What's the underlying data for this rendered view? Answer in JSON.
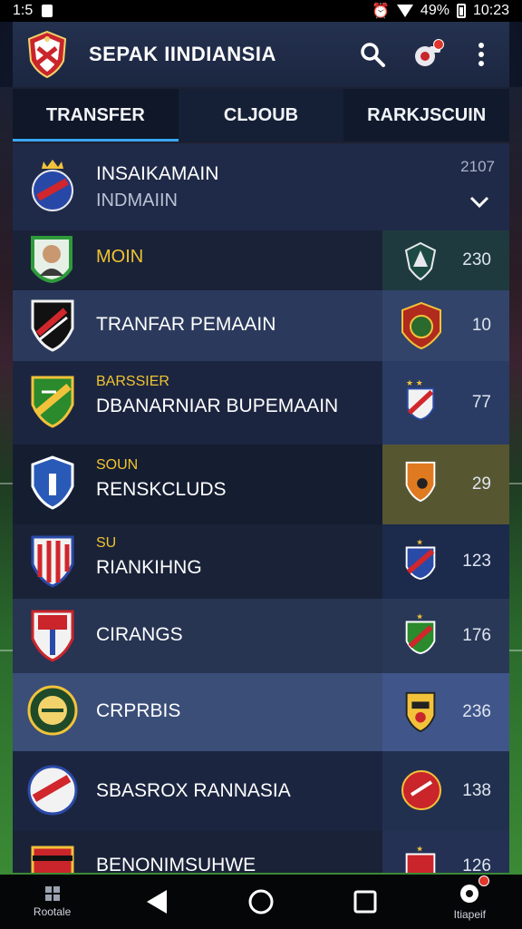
{
  "status_bar": {
    "time": "1:5",
    "battery": "49%",
    "clock": "10:23"
  },
  "app": {
    "title": "SEPAK IINDIANSIA"
  },
  "tabs": [
    {
      "label": "TRANSFER",
      "active": true
    },
    {
      "label": "CLJOUB",
      "active": false
    },
    {
      "label": "RARKJSCUIN",
      "active": false
    }
  ],
  "header_row": {
    "title": "INSAIKAMAIN",
    "subtitle": "INDMAIIN",
    "value": "2107"
  },
  "rows": [
    {
      "line1": "MOIN",
      "line2": "",
      "value": "230"
    },
    {
      "line1": "",
      "line2": "TRANFAR PEMAAIN",
      "value": "10"
    },
    {
      "line1": "BARSSIER",
      "line2": "DBANARNIAR BUPEMAAIN",
      "value": "77"
    },
    {
      "line1": "SOUN",
      "line2": "RENSKCLUDS",
      "value": "29"
    },
    {
      "line1": "SU",
      "line2": "RIANKIHNG",
      "value": "123"
    },
    {
      "line1": "",
      "line2": "CIRANGS",
      "value": "176"
    },
    {
      "line1": "",
      "line2": "CRPRBIS",
      "value": "236"
    },
    {
      "line1": "",
      "line2": "SBASROX RANNASIA",
      "value": "138"
    },
    {
      "line1": "",
      "line2": "BENONIMSUHWE",
      "value": "126"
    }
  ],
  "nav": {
    "left_caption": "Rootale",
    "right_caption": "Itiapeif"
  },
  "colors": {
    "accent": "#38a8ff",
    "highlight_text": "#f0c431",
    "notification": "#e0362b"
  }
}
